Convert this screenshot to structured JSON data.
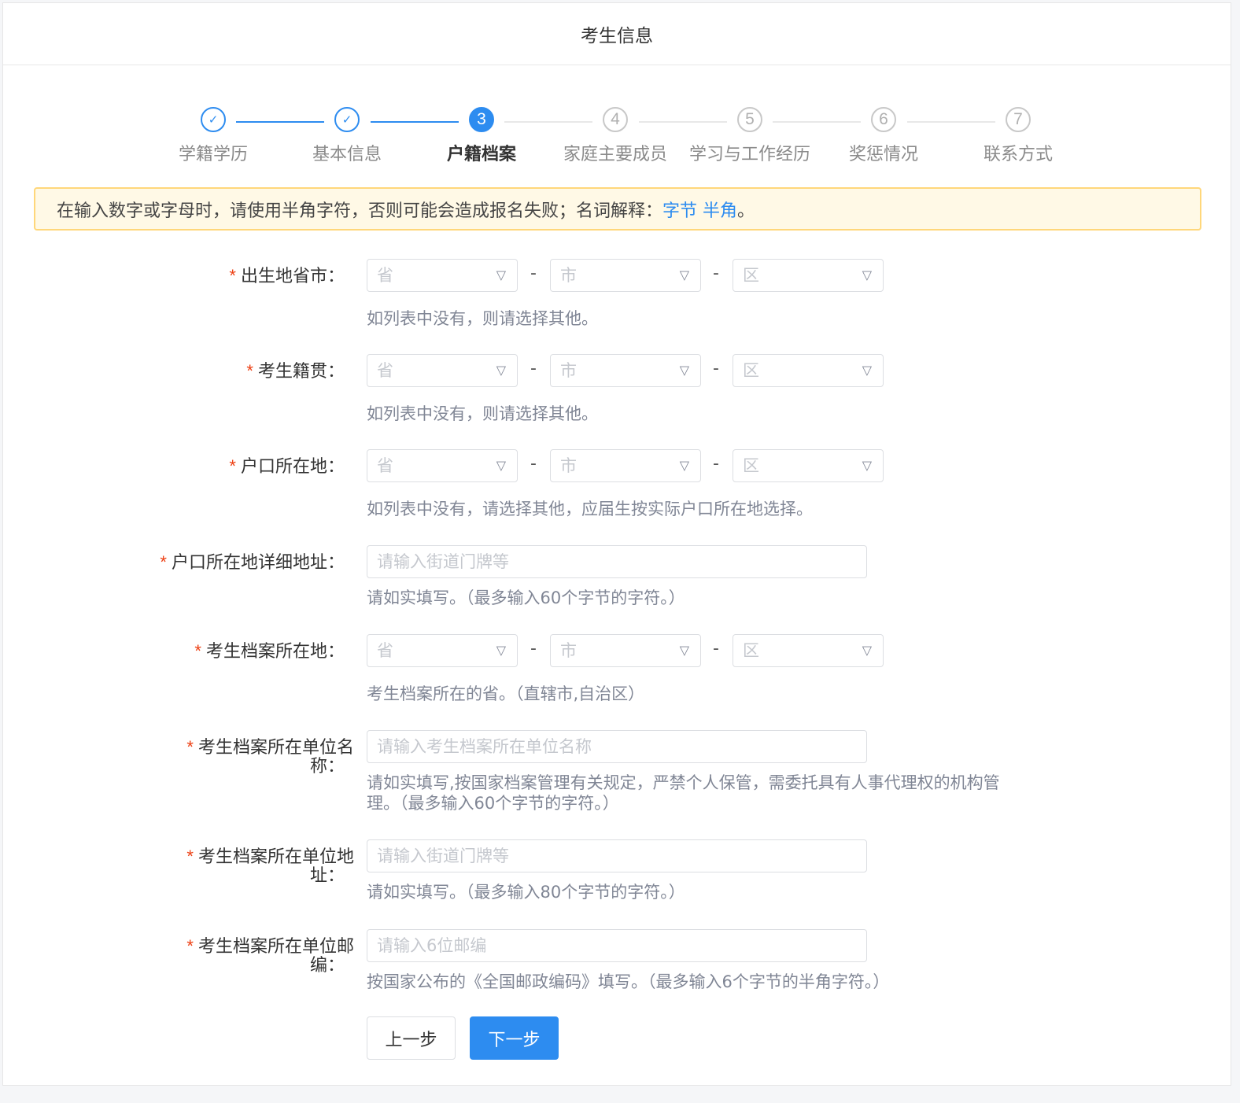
{
  "header": {
    "title": "考生信息"
  },
  "steps": [
    {
      "label": "学籍学历",
      "status": "done",
      "mark": "✓"
    },
    {
      "label": "基本信息",
      "status": "done",
      "mark": "✓"
    },
    {
      "label": "户籍档案",
      "status": "active",
      "mark": "3"
    },
    {
      "label": "家庭主要成员",
      "status": "todo",
      "mark": "4"
    },
    {
      "label": "学习与工作经历",
      "status": "todo",
      "mark": "5"
    },
    {
      "label": "奖惩情况",
      "status": "todo",
      "mark": "6"
    },
    {
      "label": "联系方式",
      "status": "todo",
      "mark": "7"
    }
  ],
  "alert": {
    "text": "在输入数字或字母时，请使用半角字符，否则可能会造成报名失败；名词解释：",
    "link1": "字节",
    "link2": "半角",
    "end": "。"
  },
  "colors": {
    "primary": "#2d8cf0",
    "required": "#ed4014",
    "alert_bg": "#fff9e6",
    "alert_border": "#ffd77a"
  },
  "form": {
    "select_placeholders": {
      "province": "省",
      "city": "市",
      "district": "区"
    },
    "dash": "-",
    "birthplace": {
      "star": "*",
      "label": "出生地省市：",
      "hint": "如列表中没有，则请选择其他。"
    },
    "native": {
      "star": "*",
      "label": "考生籍贯：",
      "hint": "如列表中没有，则请选择其他。"
    },
    "hukou": {
      "star": "*",
      "label": "户口所在地：",
      "hint": "如列表中没有，请选择其他，应届生按实际户口所在地选择。"
    },
    "hukou_address": {
      "star": "*",
      "label": "户口所在地详细地址：",
      "placeholder": "请输入街道门牌等",
      "hint": "请如实填写。（最多输入60个字节的字符。）"
    },
    "archive_location": {
      "star": "*",
      "label": "考生档案所在地：",
      "hint": "考生档案所在的省。（直辖市,自治区）"
    },
    "archive_unit_name": {
      "star": "*",
      "label1": "考生档案所在单位名",
      "label2": "称：",
      "placeholder": "请输入考生档案所在单位名称",
      "hint1": "请如实填写,按国家档案管理有关规定，严禁个人保管，需委托具有人事代理权的机构管",
      "hint2": "理。（最多输入60个字节的字符。）"
    },
    "archive_unit_address": {
      "star": "*",
      "label1": "考生档案所在单位地",
      "label2": "址：",
      "placeholder": "请输入街道门牌等",
      "hint": "请如实填写。（最多输入80个字节的字符。）"
    },
    "archive_unit_postcode": {
      "star": "*",
      "label1": "考生档案所在单位邮",
      "label2": "编：",
      "placeholder": "请输入6位邮编",
      "hint": "按国家公布的《全国邮政编码》填写。（最多输入6个字节的半角字符。）"
    }
  },
  "buttons": {
    "prev": "上一步",
    "next": "下一步"
  }
}
